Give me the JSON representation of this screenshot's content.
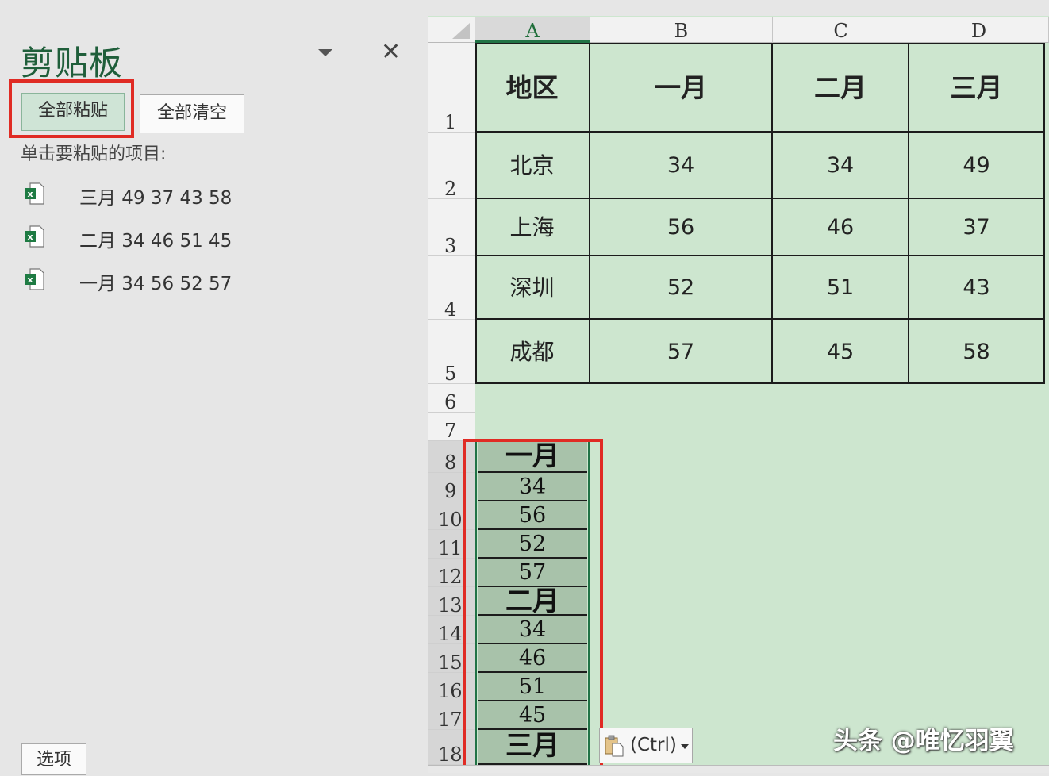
{
  "clipboard": {
    "title": "剪贴板",
    "paste_all": "全部粘贴",
    "clear_all": "全部清空",
    "hint": "单击要粘贴的项目:",
    "items": [
      {
        "text": "三月 49 37 43 58",
        "icon": "excel-icon"
      },
      {
        "text": "二月 34 46 51 45",
        "icon": "excel-icon"
      },
      {
        "text": "一月 34 56 52 57",
        "icon": "excel-icon"
      }
    ],
    "options": "选项",
    "close_icon": "close-icon",
    "dropdown_icon": "chevron-down-icon"
  },
  "sheet": {
    "columns": [
      "A",
      "B",
      "C",
      "D"
    ],
    "rows": [
      "1",
      "2",
      "3",
      "4",
      "5",
      "6",
      "7",
      "8",
      "9",
      "10",
      "11",
      "12",
      "13",
      "14",
      "15",
      "16",
      "17",
      "18"
    ],
    "table": {
      "header": [
        "地区",
        "一月",
        "二月",
        "三月"
      ],
      "body": [
        [
          "北京",
          "34",
          "34",
          "49"
        ],
        [
          "上海",
          "56",
          "46",
          "37"
        ],
        [
          "深圳",
          "52",
          "51",
          "43"
        ],
        [
          "成都",
          "57",
          "45",
          "58"
        ]
      ]
    },
    "pasted": [
      "一月",
      "34",
      "56",
      "52",
      "57",
      "二月",
      "34",
      "46",
      "51",
      "45",
      "三月"
    ],
    "paste_options_label": "(Ctrl)",
    "selected_column": "A"
  },
  "colors": {
    "accent_green": "#217346",
    "highlight_red": "#e02b24",
    "cell_fill": "#cde6cf",
    "pasted_fill": "#a8c2aa"
  },
  "watermark": "头条 @唯忆羽翼"
}
